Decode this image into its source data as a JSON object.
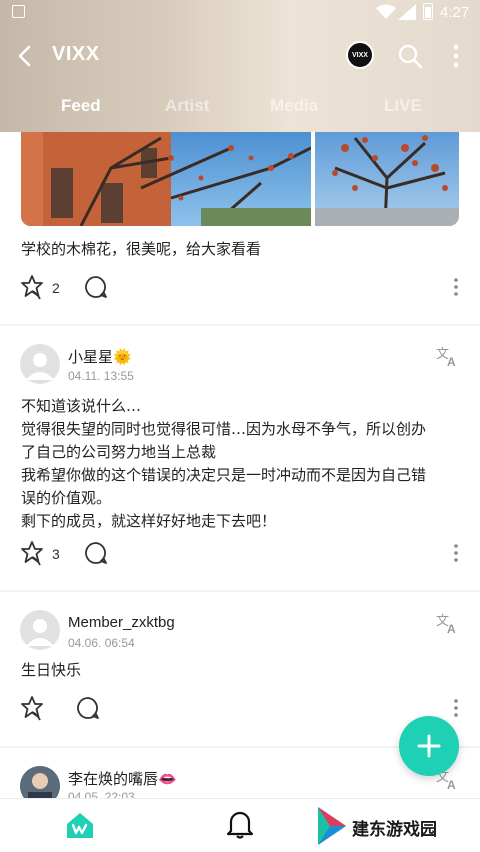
{
  "status_bar": {
    "time": "4:27"
  },
  "header": {
    "title": "VIXX",
    "brand_logo_text": "VIXX",
    "tabs": [
      {
        "label": "Feed",
        "active": true
      },
      {
        "label": "Artist",
        "active": false
      },
      {
        "label": "Media",
        "active": false
      },
      {
        "label": "LIVE",
        "active": false
      }
    ]
  },
  "posts": [
    {
      "text": "学校的木棉花，很美呢，给大家看看",
      "likes": "2"
    },
    {
      "author": "小星星",
      "author_emoji": "🌞",
      "date": "04.11. 13:55",
      "text_lines": [
        "不知道该说什么…",
        "觉得很失望的同时也觉得很可惜…因为水母不争气，所以创办",
        "了自己的公司努力地当上总裁",
        "我希望你做的这个错误的决定只是一时冲动而不是因为自己错",
        "误的价值观。",
        "剩下的成员，就这样好好地走下去吧！"
      ],
      "likes": "3"
    },
    {
      "author": "Member_zxktbg",
      "date": "04.06. 06:54",
      "text": "生日快乐"
    },
    {
      "author": "李在焕的嘴唇",
      "author_emoji": "👄",
      "date": "04.05. 22:03"
    }
  ],
  "watermark": {
    "text": "建东游戏园"
  },
  "colors": {
    "accent": "#1ed0b4",
    "header_gradient_start": "#c5b8a8",
    "header_gradient_end": "#e3d9cd"
  },
  "icons": [
    "back-icon",
    "search-icon",
    "more-vertical-icon",
    "like-icon",
    "comment-icon",
    "translate-icon",
    "plus-icon",
    "home-icon",
    "bell-icon"
  ]
}
